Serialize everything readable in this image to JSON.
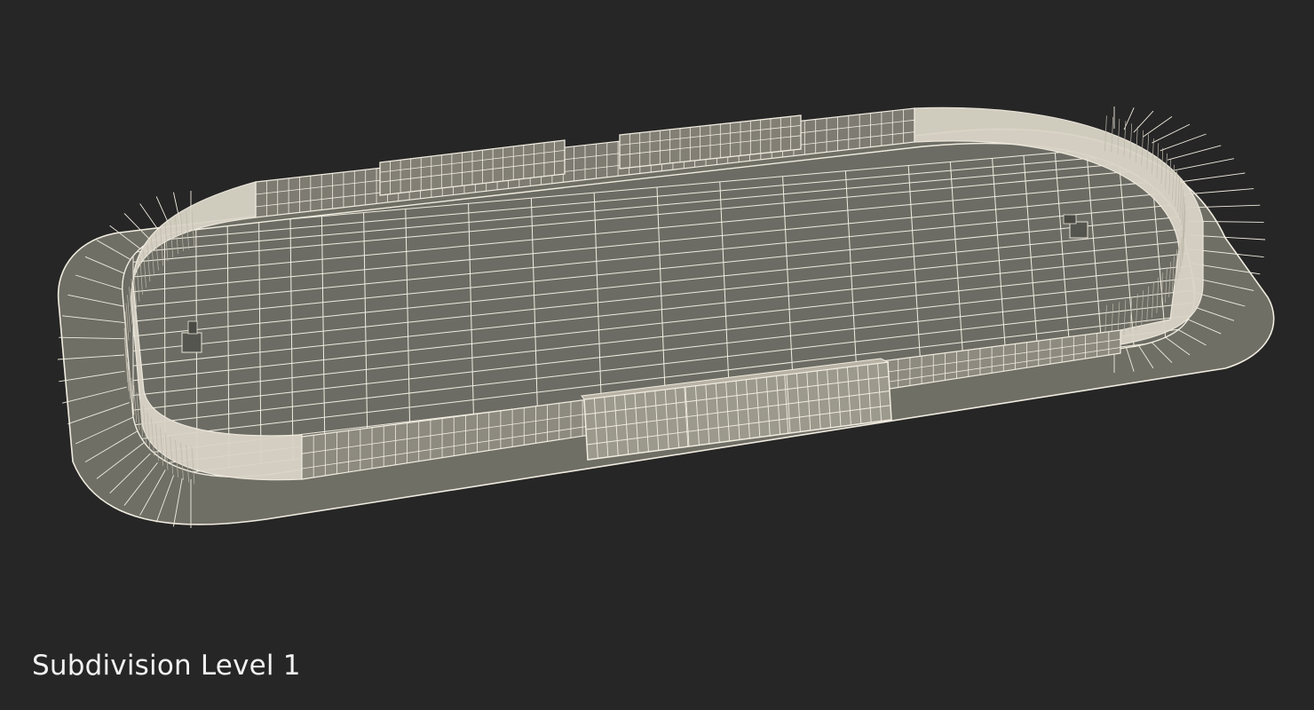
{
  "caption": "Subdivision Level 1",
  "colors": {
    "background": "#262626",
    "surface": "#6f6f66",
    "wire": "#f1ece0",
    "board_fill": "#8d8a7f"
  },
  "subject": "ice-hockey-rink-wireframe"
}
